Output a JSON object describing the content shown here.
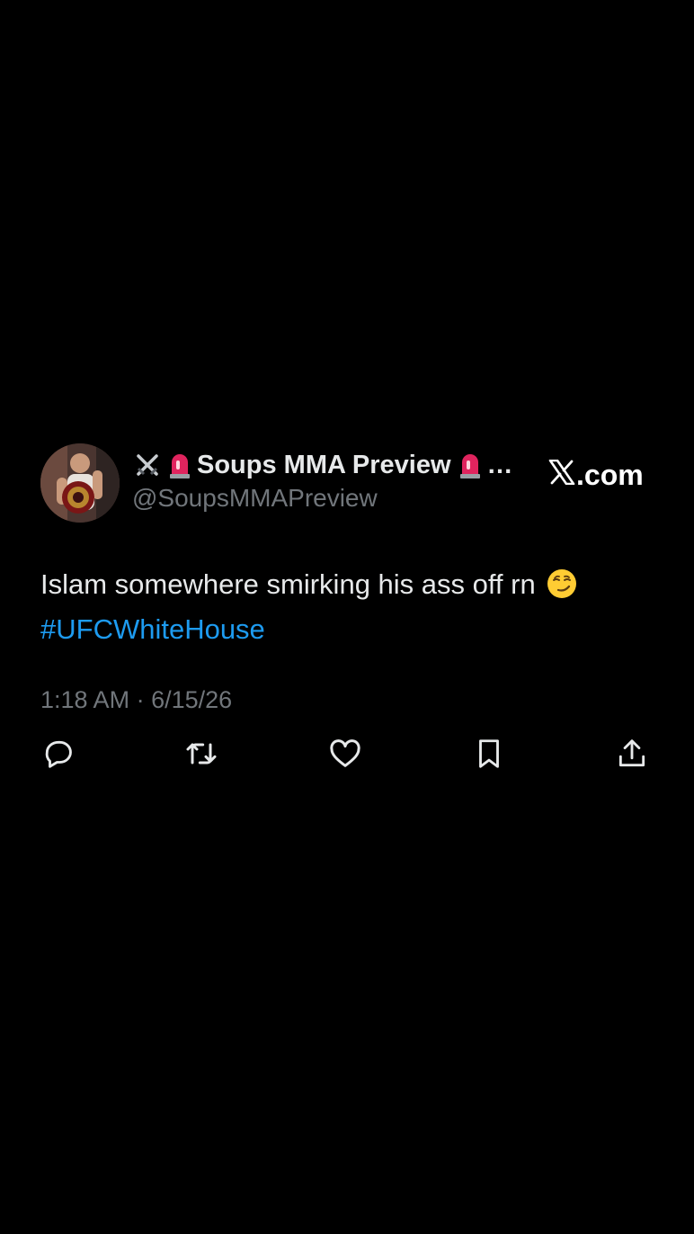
{
  "tweet": {
    "display_name": "Soups MMA Preview",
    "name_truncation": "…",
    "handle": "@SoupsMMAPreview",
    "text": "Islam somewhere smirking his ass off rn",
    "hashtag": "#UFCWhiteHouse",
    "time": "1:18 AM",
    "separator": "·",
    "date": "6/15/26"
  },
  "brand": {
    "suffix": ".com"
  },
  "icons": {
    "name_prefix": [
      "crossed-swords-icon",
      "siren-icon"
    ],
    "name_suffix": [
      "siren-icon"
    ],
    "text_emoji": "smirking-face-icon",
    "actions": [
      "reply-icon",
      "retweet-icon",
      "like-icon",
      "bookmark-icon",
      "share-icon"
    ]
  },
  "colors": {
    "background": "#000000",
    "primary_text": "#e7e9ea",
    "secondary_text": "#71767b",
    "link": "#1d9bf0"
  }
}
